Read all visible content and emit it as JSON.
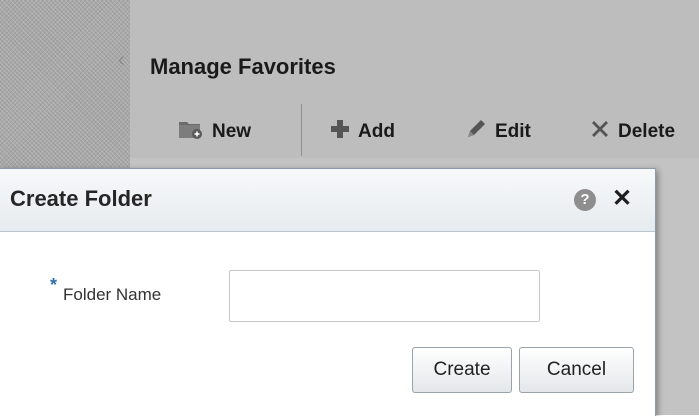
{
  "background": {
    "title": "Manage Favorites",
    "toolbar": {
      "new_label": "New",
      "add_label": "Add",
      "edit_label": "Edit",
      "delete_label": "Delete"
    }
  },
  "dialog": {
    "title": "Create Folder",
    "help_glyph": "?",
    "close_glyph": "✕",
    "required_marker": "*",
    "field_label": "Folder Name",
    "field_value": "",
    "create_label": "Create",
    "cancel_label": "Cancel"
  },
  "icons": {
    "collapse": "chevron-left-icon",
    "new": "new-folder-icon",
    "add": "plus-icon",
    "edit": "pencil-icon",
    "delete": "x-icon",
    "help": "help-icon",
    "close": "close-icon"
  },
  "colors": {
    "overlay": "#bdbdbd",
    "required_star": "#2f6ea3",
    "dialog_header": "#e6ebef"
  }
}
